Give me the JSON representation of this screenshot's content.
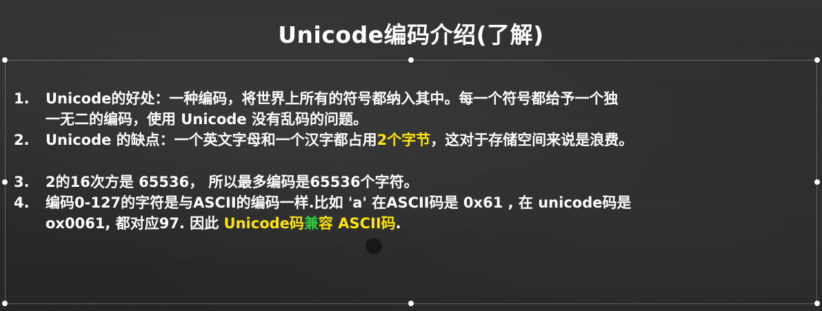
{
  "slide": {
    "title": "Unicode编码介绍(了解)",
    "items": [
      {
        "number": "1.",
        "line1": "Unicode的好处：一种编码，将世界上所有的符号都纳入其中。每一个符号都给予一个独",
        "line2": "一无二的编码，使用 Unicode 没有乱码的问题。"
      },
      {
        "number": "2.",
        "prefix": "Unicode 的缺点：一个英文字母和一个汉字都占用",
        "highlight": "2个字节",
        "suffix": "，这对于存储空间来说是浪费。"
      },
      {
        "number": "3.",
        "text": "2的16次方是 65536， 所以最多编码是65536个字符。"
      },
      {
        "number": "4.",
        "line1": "编码0-127的字符是与ASCII的编码一样.比如 'a' 在ASCII码是 0x61 , 在 unicode码是",
        "line2_prefix": "ox0061, 都对应97. 因此 ",
        "highlight_a": "Unicode码",
        "highlight_green": "兼",
        "highlight_b": "容 ASCII码",
        "line2_suffix": "."
      }
    ]
  },
  "colors": {
    "background": "#2b2b2b",
    "text": "#ffffff",
    "highlight": "#ffe600",
    "highlight_green": "#2ecc40"
  }
}
